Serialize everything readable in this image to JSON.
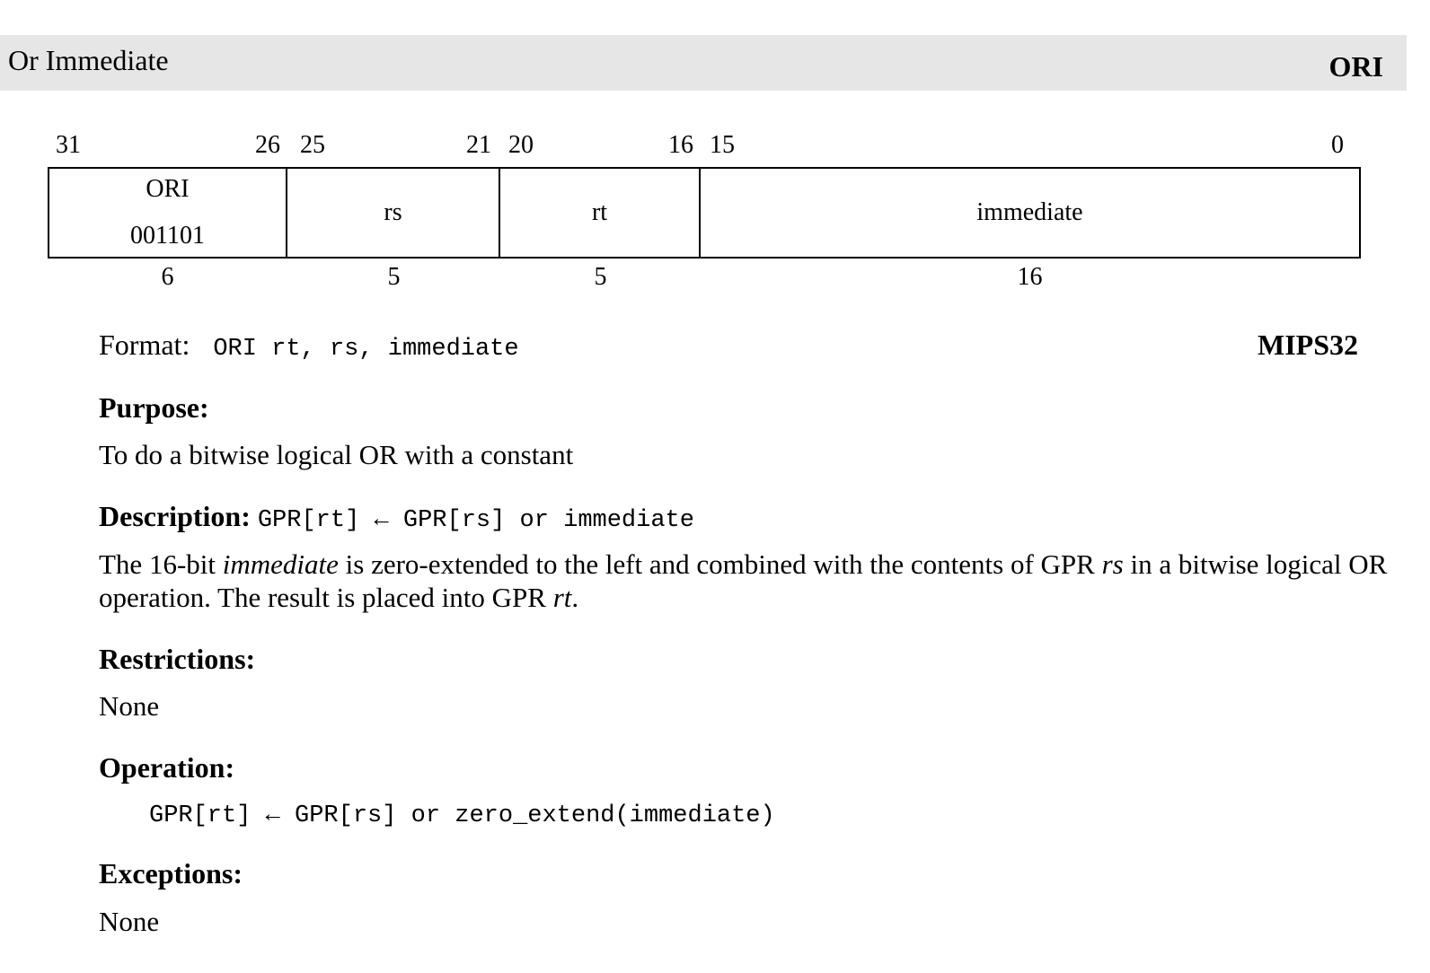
{
  "header": {
    "title": "Or Immediate",
    "mnemonic": "ORI"
  },
  "encoding": {
    "bit_labels": [
      "31",
      "26",
      "25",
      "21",
      "20",
      "16",
      "15",
      "0"
    ],
    "fields": [
      {
        "name": "ORI",
        "value": "001101",
        "width": "6"
      },
      {
        "name": "rs",
        "width": "5"
      },
      {
        "name": "rt",
        "width": "5"
      },
      {
        "name": "immediate",
        "width": "16"
      }
    ]
  },
  "format": {
    "label": "Format:",
    "syntax": "ORI rt, rs, immediate",
    "architecture": "MIPS32"
  },
  "purpose": {
    "heading": "Purpose:",
    "text": "To do a bitwise logical OR with a constant"
  },
  "description": {
    "heading": "Description:",
    "formula": "GPR[rt] ← GPR[rs] or immediate",
    "text_parts": [
      "The 16-bit ",
      "immediate",
      " is zero-extended to the left and combined with the contents of GPR ",
      "rs",
      " in a bitwise logical OR operation. The result is placed into GPR ",
      "rt",
      "."
    ]
  },
  "restrictions": {
    "heading": "Restrictions:",
    "text": "None"
  },
  "operation": {
    "heading": "Operation:",
    "code": "GPR[rt] ← GPR[rs] or zero_extend(immediate)"
  },
  "exceptions": {
    "heading": "Exceptions:",
    "text": "None"
  }
}
